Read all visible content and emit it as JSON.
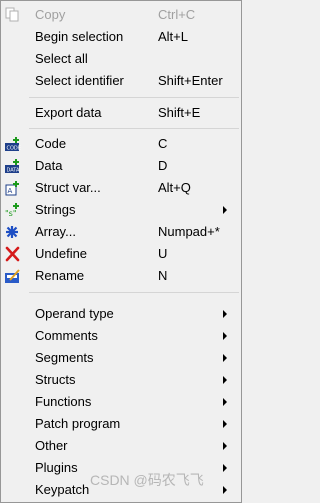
{
  "menu": {
    "copy": {
      "label": "Copy",
      "shortcut": "Ctrl+C"
    },
    "begin_selection": {
      "label": "Begin selection",
      "shortcut": "Alt+L"
    },
    "select_all": {
      "label": "Select all"
    },
    "select_identifier": {
      "label": "Select identifier",
      "shortcut": "Shift+Enter"
    },
    "export_data": {
      "label": "Export data",
      "shortcut": "Shift+E"
    },
    "code": {
      "label": "Code",
      "shortcut": "C",
      "icon": "code-icon"
    },
    "data": {
      "label": "Data",
      "shortcut": "D",
      "icon": "data-icon"
    },
    "struct_var": {
      "label": "Struct var...",
      "shortcut": "Alt+Q",
      "icon": "struct-icon"
    },
    "strings": {
      "label": "Strings",
      "icon": "strings-icon"
    },
    "array": {
      "label": "Array...",
      "shortcut": "Numpad+*",
      "icon": "array-icon"
    },
    "undefine": {
      "label": "Undefine",
      "shortcut": "U",
      "icon": "undefine-icon"
    },
    "rename": {
      "label": "Rename",
      "shortcut": "N",
      "icon": "rename-icon"
    },
    "operand_type": {
      "label": "Operand type"
    },
    "comments": {
      "label": "Comments"
    },
    "segments": {
      "label": "Segments"
    },
    "structs": {
      "label": "Structs"
    },
    "functions": {
      "label": "Functions"
    },
    "patch_program": {
      "label": "Patch program"
    },
    "other": {
      "label": "Other"
    },
    "plugins": {
      "label": "Plugins"
    },
    "keypatch": {
      "label": "Keypatch"
    }
  },
  "watermark": "CSDN @码农飞飞"
}
